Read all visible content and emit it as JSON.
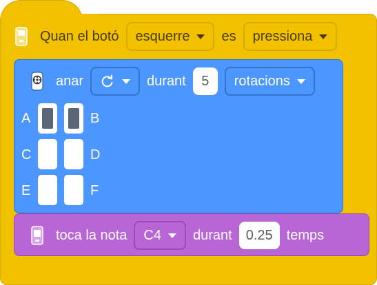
{
  "colors": {
    "hat": "#f2c100",
    "motion": "#4c97ff",
    "sound": "#b866d6"
  },
  "hat_block": {
    "prefix": "Quan el botó",
    "button_dropdown": "esquerre",
    "middle": "es",
    "state_dropdown": "pressiona",
    "icon": "device-hub-icon"
  },
  "motor_block": {
    "icon": "motor-icon",
    "verb": "anar",
    "direction_icon": "rotate-clockwise-icon",
    "during": "durant",
    "amount": "5",
    "unit_dropdown": "rotacions",
    "ports": [
      {
        "label": "A",
        "selected": true
      },
      {
        "label": "B",
        "selected": true
      },
      {
        "label": "C",
        "selected": false
      },
      {
        "label": "D",
        "selected": false
      },
      {
        "label": "E",
        "selected": false
      },
      {
        "label": "F",
        "selected": false
      }
    ]
  },
  "sound_block": {
    "icon": "device-hub-icon",
    "verb": "toca la nota",
    "note_dropdown": "C4",
    "during": "durant",
    "beats": "0.25",
    "unit": "temps"
  }
}
